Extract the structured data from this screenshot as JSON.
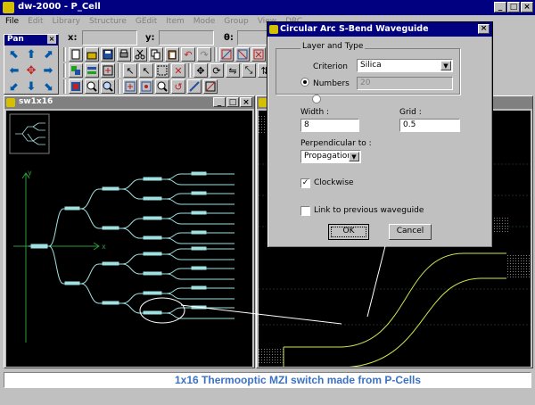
{
  "app": {
    "title": "dw-2000 - P_Cell",
    "min": "_",
    "max": "□",
    "close": "×"
  },
  "menu": [
    "File",
    "Edit",
    "Library",
    "Structure",
    "GEdit",
    "Item",
    "Mode",
    "Group",
    "View",
    "DRC"
  ],
  "coords": {
    "x_label": "x:",
    "y_label": "y:",
    "theta_label": "θ:"
  },
  "pan": {
    "title": "Pan",
    "close": "×",
    "arrows": [
      "⬉",
      "⬆",
      "⬈",
      "⬅",
      "✥",
      "➡",
      "⬋",
      "⬇",
      "⬊"
    ]
  },
  "child_window": {
    "title": "sw1x16",
    "axis_x": "x",
    "axis_y": "y"
  },
  "dialog": {
    "title": "Circular Arc S-Bend Waveguide",
    "close": "×",
    "layer_group": "Layer and Type",
    "criterion_label": "Criterion",
    "criterion_value": "Silica",
    "numbers_label": "Numbers",
    "numbers_value": "20",
    "width_label": "Width :",
    "width_value": "8",
    "grid_label": "Grid :",
    "grid_value": "0.5",
    "perp_label": "Perpendicular to :",
    "perp_value": "Propagation",
    "clockwise_label": "Clockwise",
    "clockwise_checked": true,
    "link_label": "Link to previous waveguide",
    "link_checked": false,
    "ok_label": "OK",
    "cancel_label": "Cancel"
  },
  "caption": "1x16 Thermooptic MZI switch made from P-Cells",
  "colors": {
    "waveguide": "#9fe0e0",
    "bend": "#c8e850",
    "axis": "#2e9a3a",
    "caption": "#3b72c4"
  }
}
